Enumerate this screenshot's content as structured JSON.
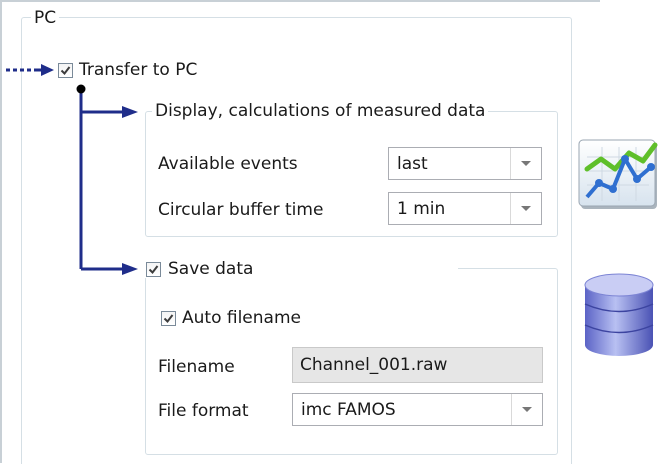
{
  "pc_group": {
    "title": "PC"
  },
  "transfer": {
    "label": "Transfer to PC",
    "checked": true
  },
  "display_group": {
    "title": "Display, calculations of measured data",
    "available_events": {
      "label": "Available events",
      "value": "last"
    },
    "circular_buffer": {
      "label": "Circular buffer time",
      "value": "1 min"
    }
  },
  "save": {
    "label": "Save data",
    "checked": true,
    "auto_filename": {
      "label": "Auto filename",
      "checked": true
    },
    "filename": {
      "label": "Filename",
      "value": "Channel_001.raw"
    },
    "file_format": {
      "label": "File format",
      "value": "imc FAMOS"
    }
  },
  "icons": {
    "chart": "line-chart-icon",
    "database": "database-icon"
  },
  "colors": {
    "flow_line": "#1f2d8a",
    "group_border": "#d5dfe5"
  }
}
